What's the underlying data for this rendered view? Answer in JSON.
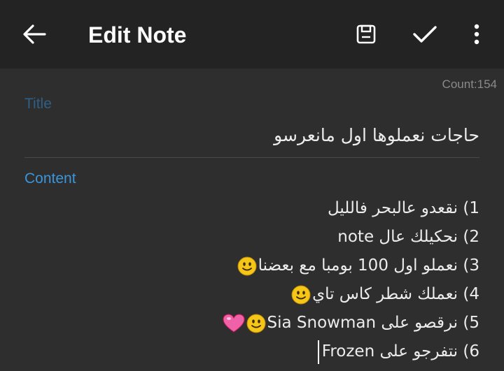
{
  "appbar": {
    "title": "Edit Note",
    "back_icon": "arrow-left-icon",
    "actions": [
      "save-icon",
      "check-icon",
      "more-vert-icon"
    ]
  },
  "editor": {
    "count": "Count:154",
    "title_label": "Title",
    "title_value": "حاجات نعملوها اول مانعرسو",
    "content_label": "Content",
    "lines": [
      "1) نقعدو عالبحر فالليل",
      "2) نحكيلك عال note",
      "3) نعملو اول 100 بومبا مع بعضنا",
      "4) نعملك شطر كاس تاي",
      "5) نرقصو على Sia Snowman",
      "6) نتفرجو على Frozen"
    ]
  },
  "colors": {
    "appbar": "#232323",
    "background": "#2e2e2e",
    "accent": "#3b95d9"
  }
}
